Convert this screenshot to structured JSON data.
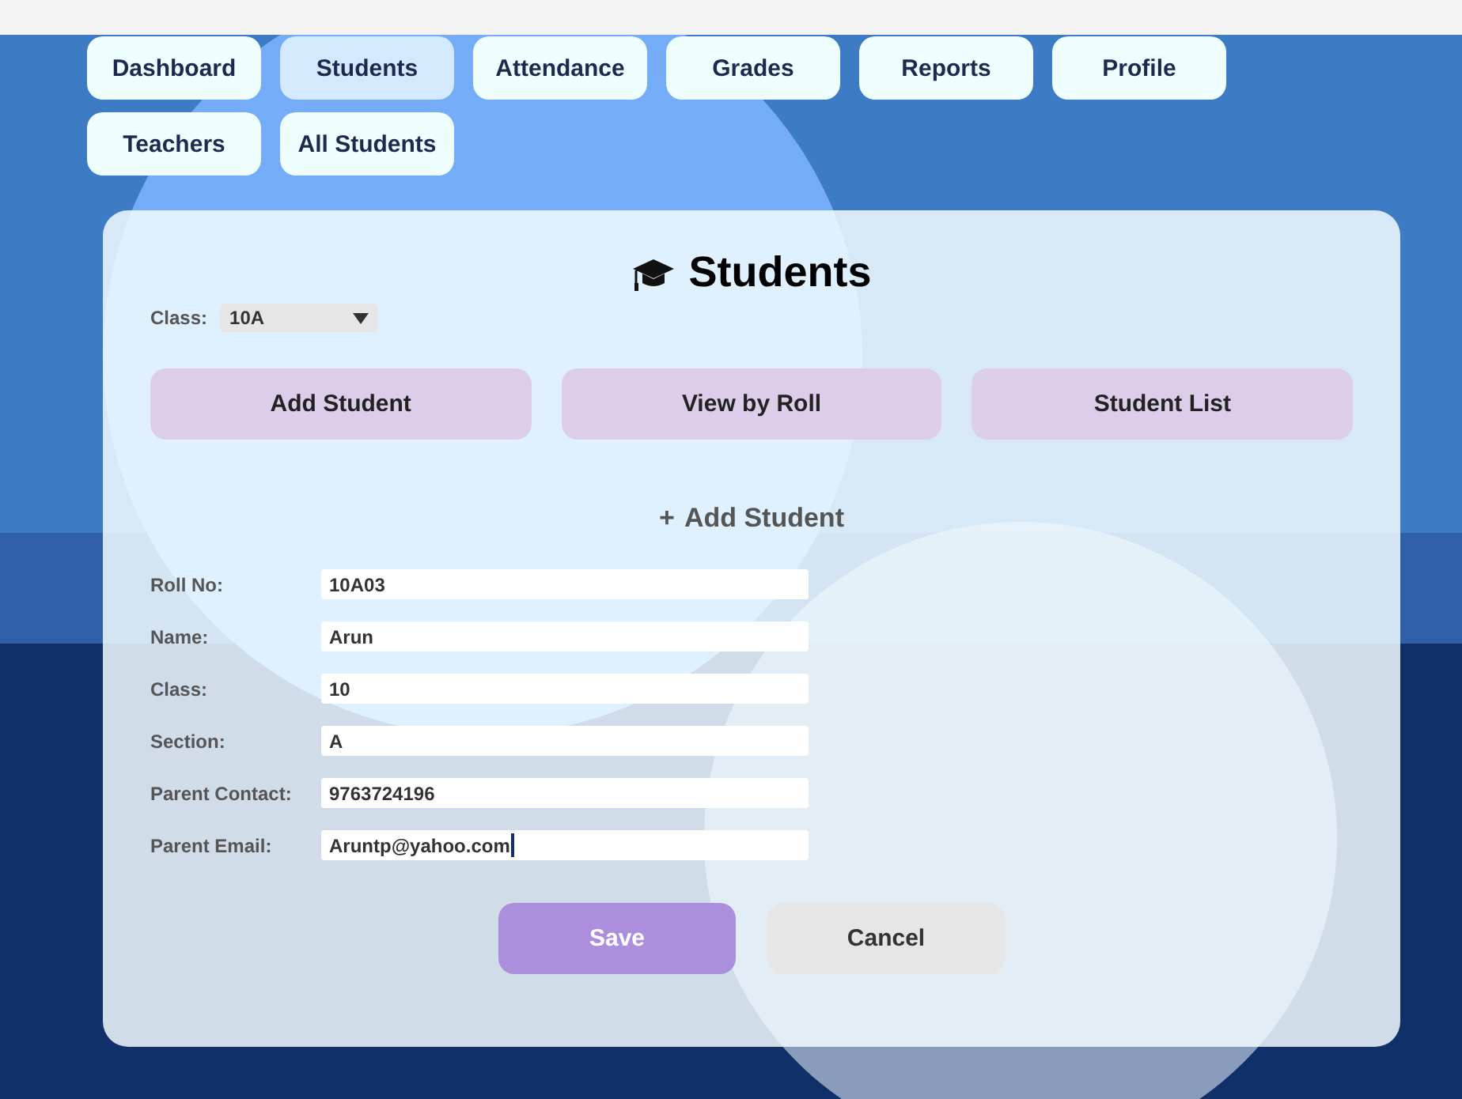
{
  "nav": [
    {
      "label": "Dashboard",
      "selected": false
    },
    {
      "label": "Students",
      "selected": true
    },
    {
      "label": "Attendance",
      "selected": false
    },
    {
      "label": "Grades",
      "selected": false
    },
    {
      "label": "Reports",
      "selected": false
    },
    {
      "label": "Profile",
      "selected": false
    },
    {
      "label": "Teachers",
      "selected": false
    },
    {
      "label": "All Students",
      "selected": false
    }
  ],
  "card": {
    "title": "Students",
    "class_select": {
      "label": "Class:",
      "value": "10A"
    },
    "actions": [
      "Add Student",
      "View by Roll",
      "Student List"
    ],
    "form": {
      "heading_icon": "+",
      "heading": "Add Student",
      "fields": [
        {
          "label": "Roll No:",
          "value": "10A03",
          "focused": false
        },
        {
          "label": "Name:",
          "value": "Arun",
          "focused": false
        },
        {
          "label": "Class:",
          "value": "10",
          "focused": false
        },
        {
          "label": "Section:",
          "value": "A",
          "focused": false
        },
        {
          "label": "Parent Contact:",
          "value": "9763724196",
          "focused": false
        },
        {
          "label": "Parent Email:",
          "value": "Aruntp@yahoo.com",
          "focused": true
        }
      ],
      "buttons": [
        {
          "label": "Save",
          "kind": "primary"
        },
        {
          "label": "Cancel",
          "kind": "secondary"
        }
      ]
    }
  }
}
